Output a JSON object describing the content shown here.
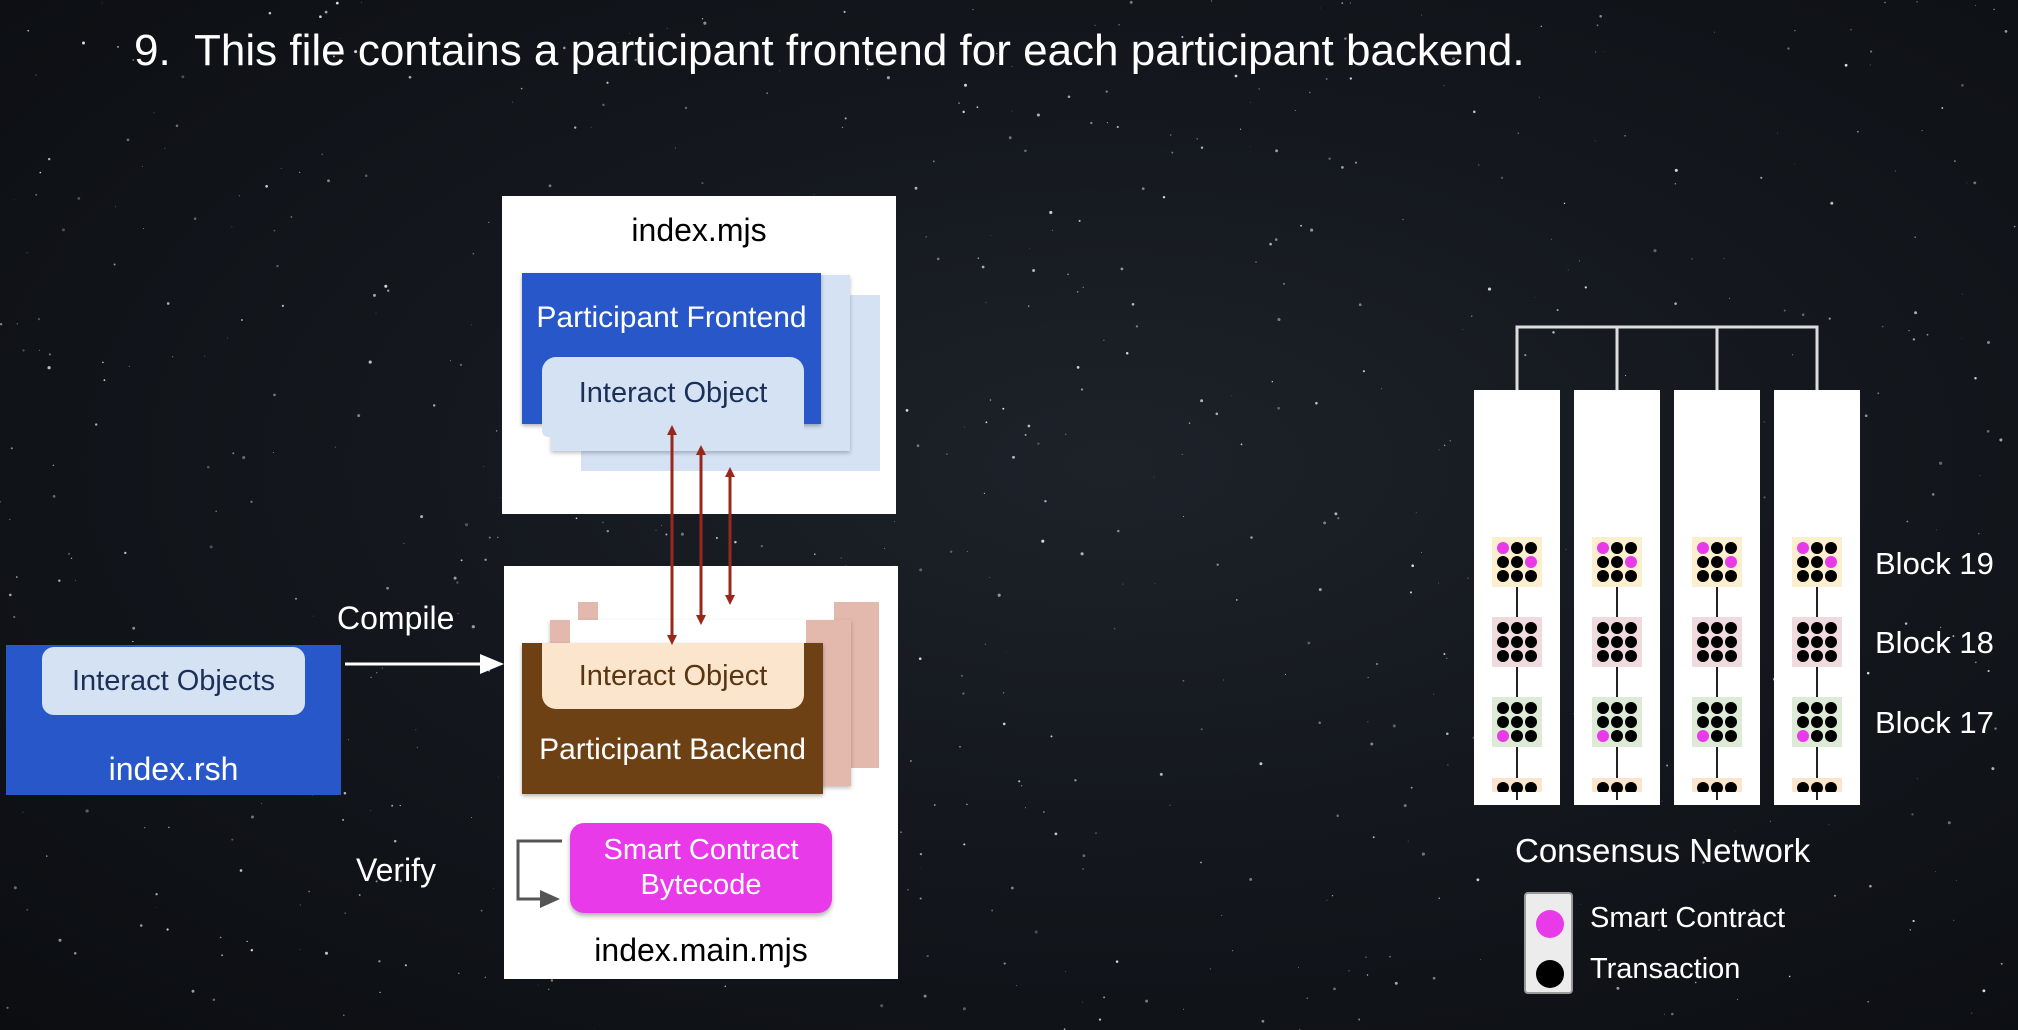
{
  "heading": {
    "number": "9.",
    "text": "This file contains a participant frontend for each participant backend."
  },
  "index_rsh": {
    "title": "index.rsh",
    "interact_label": "Interact Objects"
  },
  "labels": {
    "compile": "Compile",
    "verify": "Verify"
  },
  "index_mjs": {
    "title": "index.mjs",
    "frontend_label": "Participant Frontend",
    "interact_label": "Interact Object"
  },
  "index_main_mjs": {
    "title": "index.main.mjs",
    "backend_label": "Participant Backend",
    "interact_label": "Interact Object",
    "contract_line1": "Smart Contract",
    "contract_line2": "Bytecode"
  },
  "network": {
    "title": "Consensus Network",
    "blocks": [
      "Block 19",
      "Block 18",
      "Block 17"
    ],
    "legend": {
      "smart_contract": "Smart Contract",
      "transaction": "Transaction"
    }
  },
  "colors": {
    "frontend_blue": "#2757c9",
    "interact_light_blue": "#d4e2f4",
    "backend_brown": "#6e4115",
    "interact_peach": "#fbe5cc",
    "stack_pink": "#e3b8ad",
    "smart_contract_magenta": "#e83ae8",
    "arrow_red": "#98281c"
  }
}
